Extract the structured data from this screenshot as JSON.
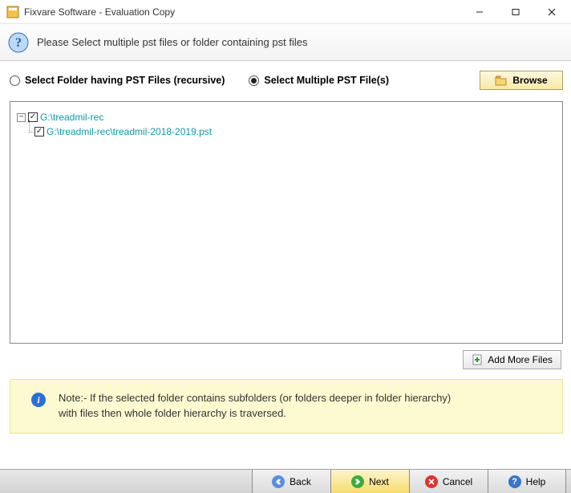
{
  "window": {
    "title": "Fixvare Software - Evaluation Copy"
  },
  "header": {
    "instruction": "Please Select multiple pst files or folder containing pst files"
  },
  "options": {
    "folder_label": "Select Folder having PST Files (recursive)",
    "multiple_label": "Select Multiple PST File(s)",
    "selected_index": 1
  },
  "browse_label": "Browse",
  "tree": {
    "root_label": "G:\\treadmil-rec",
    "child_label": "G:\\treadmil-rec\\treadmil-2018-2019.pst"
  },
  "add_more_label": "Add More Files",
  "note": {
    "line1": "Note:- If the selected folder contains subfolders (or folders deeper in folder hierarchy)",
    "line2": " with files then whole folder hierarchy is traversed."
  },
  "footer": {
    "back": "Back",
    "next": "Next",
    "cancel": "Cancel",
    "help": "Help"
  }
}
